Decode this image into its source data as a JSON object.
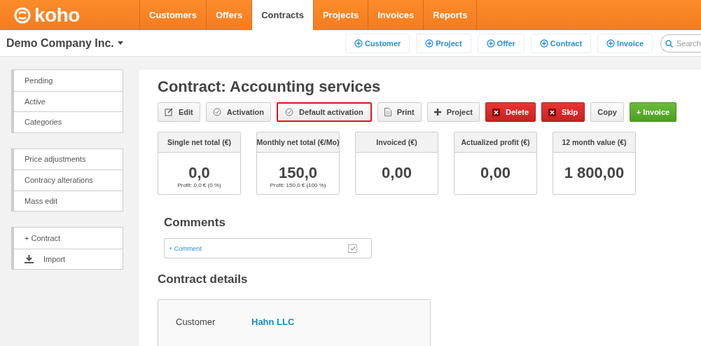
{
  "brand": {
    "name": "koho"
  },
  "nav": [
    {
      "label": "Customers",
      "selected": false
    },
    {
      "label": "Offers",
      "selected": false
    },
    {
      "label": "Contracts",
      "selected": true
    },
    {
      "label": "Projects",
      "selected": false
    },
    {
      "label": "Invoices",
      "selected": false
    },
    {
      "label": "Reports",
      "selected": false
    }
  ],
  "company": "Demo Company Inc.",
  "quick_add": [
    "Customer",
    "Project",
    "Offer",
    "Contract",
    "Invoice"
  ],
  "search": {
    "placeholder": "Search"
  },
  "sidebar": [
    [
      {
        "label": "Pending",
        "kind": "text"
      },
      {
        "label": "Active",
        "kind": "text"
      },
      {
        "label": "Categories",
        "kind": "text"
      }
    ],
    [
      {
        "label": "Price adjustments",
        "kind": "text"
      },
      {
        "label": "Contracy alterations",
        "kind": "text"
      },
      {
        "label": "Mass edit",
        "kind": "text"
      }
    ],
    [
      {
        "label": "+ Contract",
        "kind": "text"
      },
      {
        "label": "Import",
        "kind": "import"
      }
    ]
  ],
  "title": "Contract: Accounting services",
  "actions": [
    {
      "label": "Edit",
      "kind": "edit",
      "highlighted": false
    },
    {
      "label": "Activation",
      "kind": "check",
      "highlighted": false
    },
    {
      "label": "Default activation",
      "kind": "check",
      "highlighted": true
    },
    {
      "label": "Print",
      "kind": "print",
      "highlighted": false
    },
    {
      "label": "Project",
      "kind": "plus",
      "highlighted": false
    },
    {
      "label": "Delete",
      "kind": "danger",
      "highlighted": false
    },
    {
      "label": "Skip",
      "kind": "danger",
      "highlighted": false
    },
    {
      "label": "Copy",
      "kind": "plain",
      "highlighted": false
    },
    {
      "label": "+ Invoice",
      "kind": "success",
      "highlighted": false
    }
  ],
  "stats": [
    {
      "label": "Single net total (€)",
      "value": "0,0",
      "note": "Profit: 0,0 € (0 %)"
    },
    {
      "label": "Monthly net total (€/Mo)",
      "value": "150,0",
      "note": "Profit: 150,0 € (100 %)"
    },
    {
      "label": "Invoiced (€)",
      "value": "0,00"
    },
    {
      "label": "Actualized profit (€)",
      "value": "0,00"
    },
    {
      "label": "12 month value (€)",
      "value": "1 800,00"
    }
  ],
  "comments": {
    "heading": "Comments",
    "add": "+ Comment"
  },
  "details": {
    "heading": "Contract details",
    "rows": [
      {
        "label": "Customer",
        "value": "Hahn LLC"
      }
    ]
  }
}
